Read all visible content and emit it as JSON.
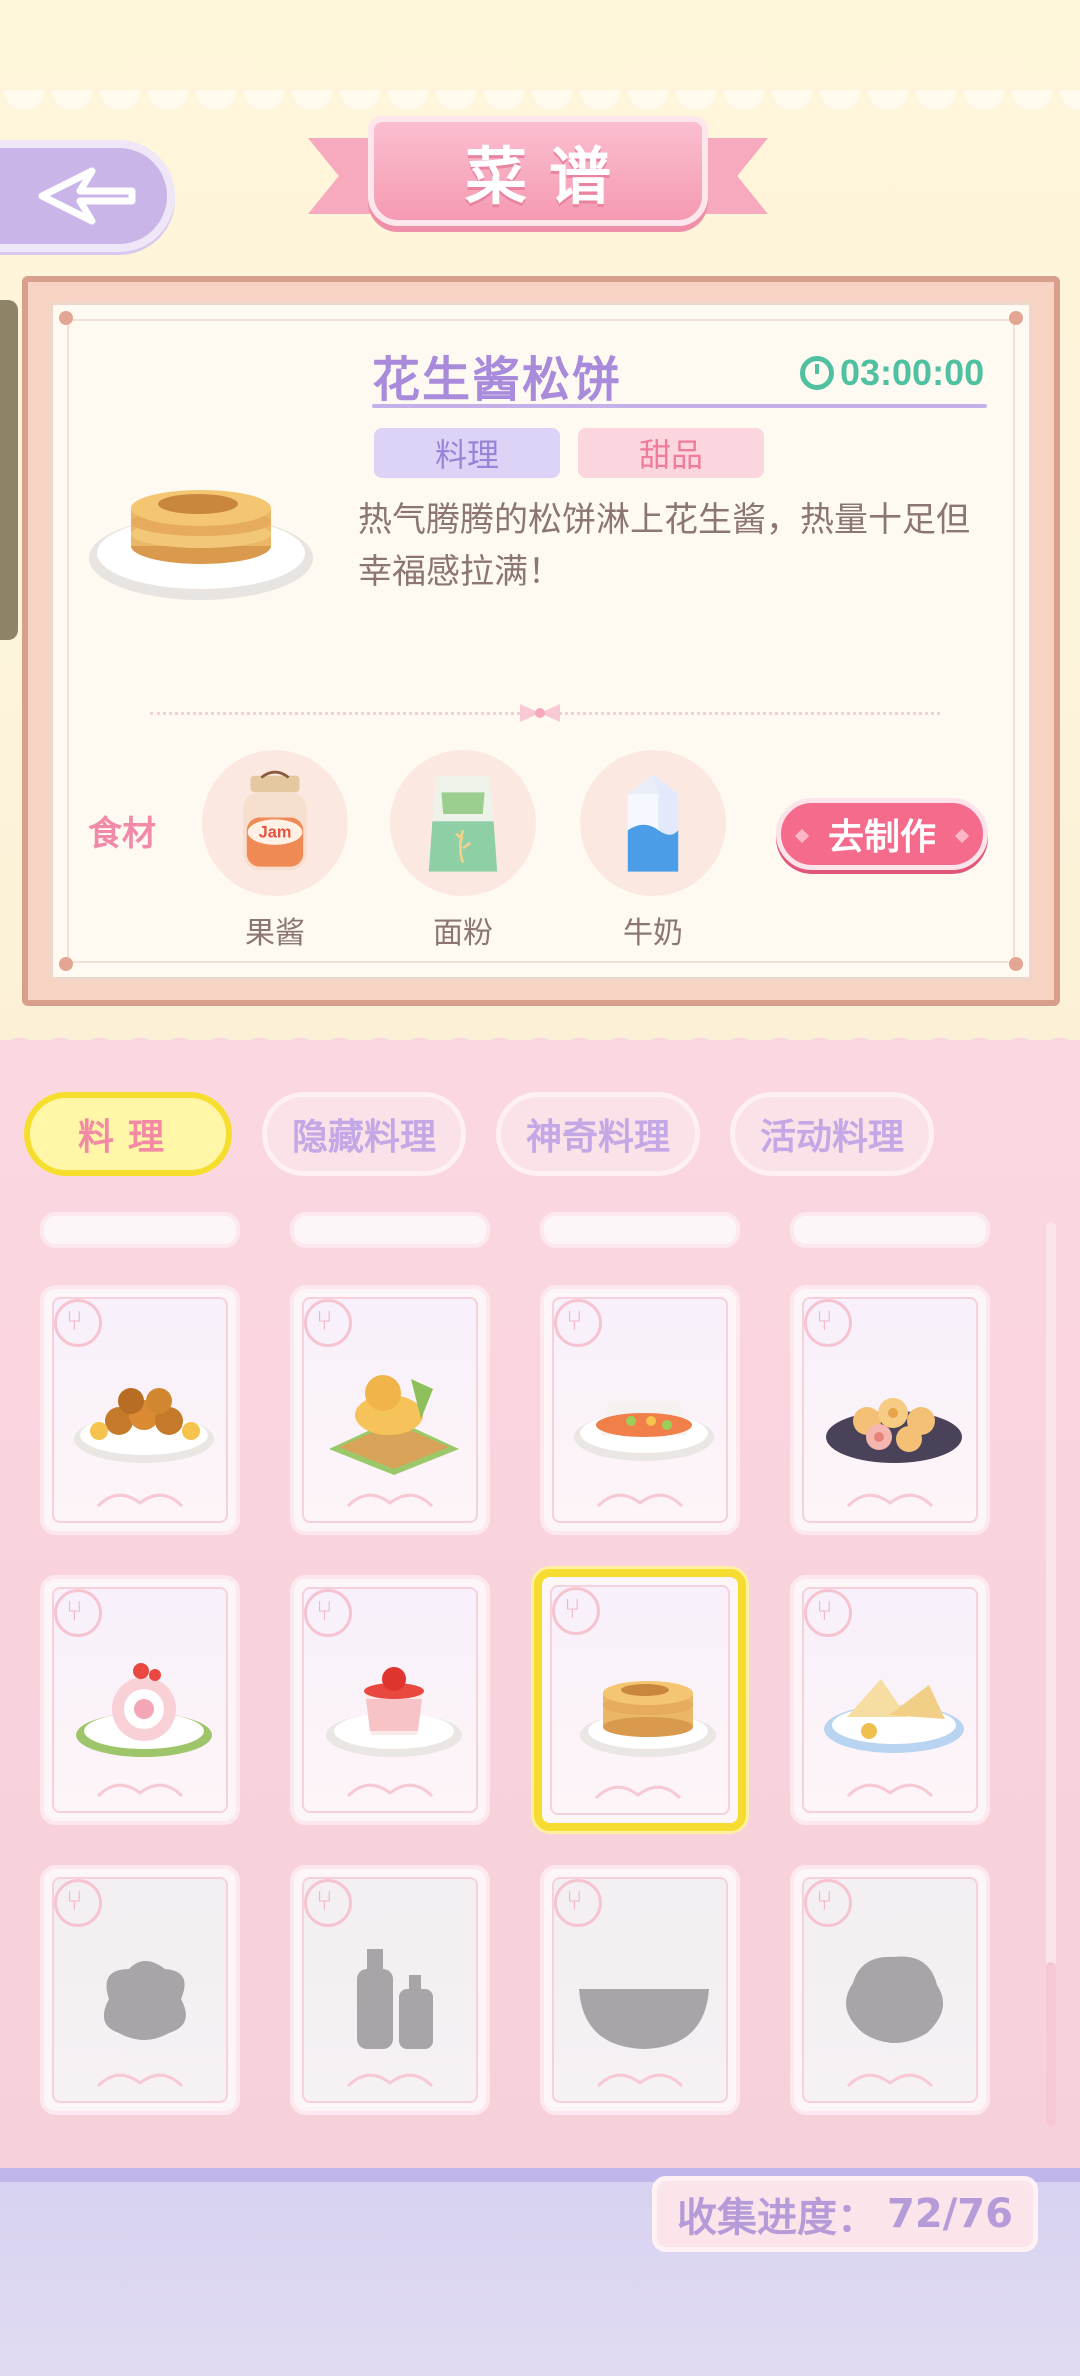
{
  "header": {
    "title": "菜谱",
    "back_icon": "back-arrow-icon"
  },
  "recipe": {
    "name": "花生酱松饼",
    "timer": "03:00:00",
    "tags": [
      "料理",
      "甜品"
    ],
    "description": "热气腾腾的松饼淋上花生酱，热量十足但幸福感拉满！",
    "ingredients_label": "食材",
    "ingredients": [
      {
        "name": "果酱",
        "icon": "jam-jar-icon"
      },
      {
        "name": "面粉",
        "icon": "flour-bag-icon"
      },
      {
        "name": "牛奶",
        "icon": "milk-carton-icon"
      }
    ],
    "make_button": "去制作"
  },
  "tabs": [
    {
      "label": "料理",
      "active": true
    },
    {
      "label": "隐藏料理",
      "active": false
    },
    {
      "label": "神奇料理",
      "active": false
    },
    {
      "label": "活动料理",
      "active": false
    }
  ],
  "grid": {
    "rows": [
      [
        {
          "icon": "orange-balls-dish-icon",
          "locked": false
        },
        {
          "icon": "toast-platter-icon",
          "locked": false
        },
        {
          "icon": "grilled-fish-dish-icon",
          "locked": false
        },
        {
          "icon": "rolled-pastry-dish-icon",
          "locked": false
        }
      ],
      [
        {
          "icon": "swiss-roll-cake-icon",
          "locked": false
        },
        {
          "icon": "strawberry-pudding-icon",
          "locked": false
        },
        {
          "icon": "pancake-stack-icon",
          "locked": false,
          "selected": true
        },
        {
          "icon": "sandwich-plate-icon",
          "locked": false
        }
      ],
      [
        {
          "icon": "locked-silhouette-icon",
          "locked": true
        },
        {
          "icon": "locked-bottles-silhouette-icon",
          "locked": true
        },
        {
          "icon": "locked-bowl-silhouette-icon",
          "locked": true
        },
        {
          "icon": "locked-round-silhouette-icon",
          "locked": true
        }
      ]
    ]
  },
  "progress": {
    "label": "收集进度：",
    "value": "72/76"
  },
  "colors": {
    "accent_purple": "#a98bdb",
    "accent_pink": "#f56b8c",
    "selected_border": "#f6dc30",
    "timer_green": "#4fc0a0"
  }
}
